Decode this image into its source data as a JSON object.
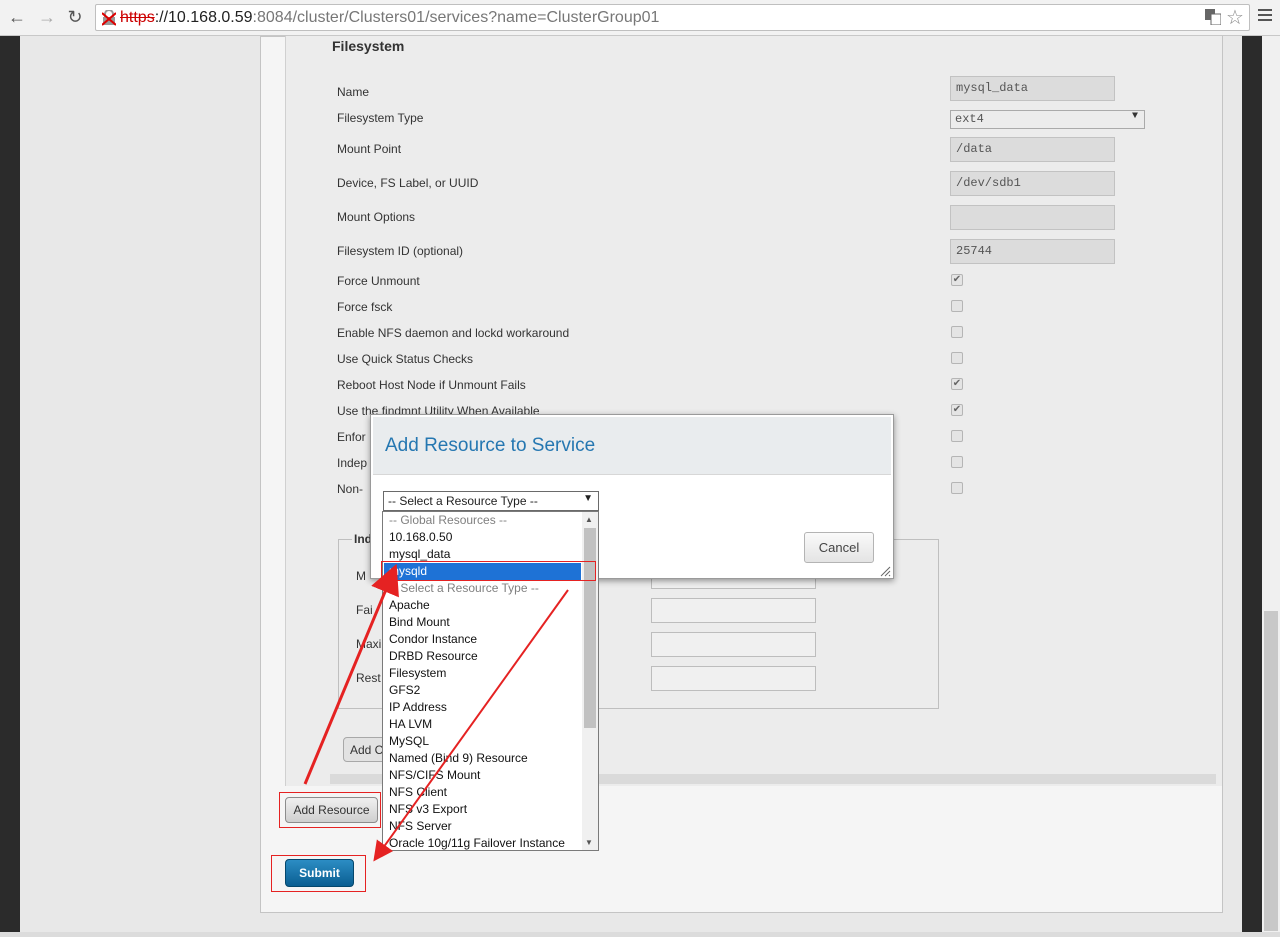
{
  "browser": {
    "url_scheme": "https",
    "url_host": "://10.168.0.59",
    "url_rest": ":8084/cluster/Clusters01/services?name=ClusterGroup01"
  },
  "section": {
    "title": "Filesystem"
  },
  "form": {
    "name_label": "Name",
    "name_value": "mysql_data",
    "fstype_label": "Filesystem Type",
    "fstype_value": "ext4",
    "mount_point_label": "Mount Point",
    "mount_point_value": "/data",
    "device_label": "Device, FS Label, or UUID",
    "device_value": "/dev/sdb1",
    "mount_options_label": "Mount Options",
    "mount_options_value": "",
    "fsid_label": "Filesystem ID (optional)",
    "fsid_value": "25744",
    "force_unmount_label": "Force Unmount",
    "force_fsck_label": "Force fsck",
    "nfs_label": "Enable NFS daemon and lockd workaround",
    "quick_status_label": "Use Quick Status Checks",
    "reboot_label": "Reboot Host Node if Unmount Fails",
    "findmnt_label": "Use the findmnt Utility When Available",
    "enforce_label": "Enfor",
    "indep_label": "Indep",
    "noncrit_label": "Non-"
  },
  "checkbox_states": {
    "force_unmount": true,
    "force_fsck": false,
    "nfs": false,
    "quick_status": false,
    "reboot": true,
    "findmnt": true,
    "enforce": false,
    "indep": false,
    "noncrit": false
  },
  "independent": {
    "legend": "Ind",
    "row1": "M",
    "row2": "Fai",
    "row3": "Maxi",
    "row4": "Rest"
  },
  "buttons": {
    "add_child": "Add C",
    "add_resource": "Add Resource",
    "submit": "Submit"
  },
  "modal": {
    "title": "Add Resource to Service",
    "select_value": "-- Select a Resource Type --",
    "cancel": "Cancel"
  },
  "dropdown": {
    "options": [
      {
        "label": "-- Global Resources --",
        "kind": "group"
      },
      {
        "label": "10.168.0.50",
        "kind": "opt"
      },
      {
        "label": "mysql_data",
        "kind": "opt"
      },
      {
        "label": "mysqld",
        "kind": "sel"
      },
      {
        "label": "-- Select a Resource Type --",
        "kind": "group"
      },
      {
        "label": "Apache",
        "kind": "opt"
      },
      {
        "label": "Bind Mount",
        "kind": "opt"
      },
      {
        "label": "Condor Instance",
        "kind": "opt"
      },
      {
        "label": "DRBD Resource",
        "kind": "opt"
      },
      {
        "label": "Filesystem",
        "kind": "opt"
      },
      {
        "label": "GFS2",
        "kind": "opt"
      },
      {
        "label": "IP Address",
        "kind": "opt"
      },
      {
        "label": "HA LVM",
        "kind": "opt"
      },
      {
        "label": "MySQL",
        "kind": "opt"
      },
      {
        "label": "Named (Bind 9) Resource",
        "kind": "opt"
      },
      {
        "label": "NFS/CIFS Mount",
        "kind": "opt"
      },
      {
        "label": "NFS Client",
        "kind": "opt"
      },
      {
        "label": "NFS v3 Export",
        "kind": "opt"
      },
      {
        "label": "NFS Server",
        "kind": "opt"
      },
      {
        "label": "Oracle 10g/11g Failover Instance",
        "kind": "opt"
      }
    ]
  },
  "annotation_color": "#e52222",
  "icons": [
    "back-icon",
    "forward-icon",
    "reload-icon",
    "lock-broken-icon",
    "translate-icon",
    "star-icon",
    "menu-icon"
  ]
}
